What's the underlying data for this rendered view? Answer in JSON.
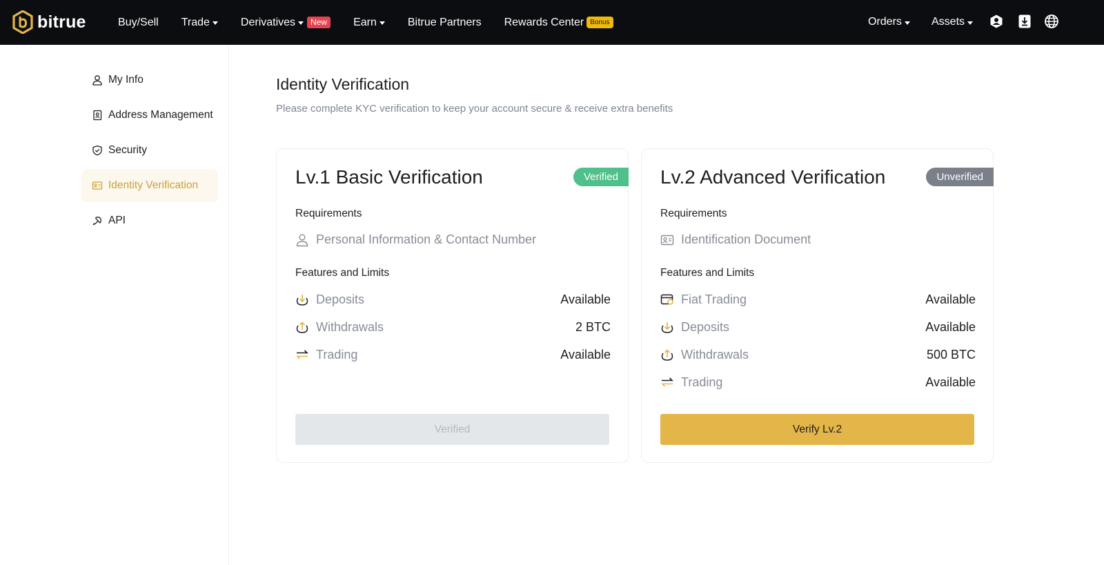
{
  "header": {
    "brand": "bitrue",
    "nav": [
      {
        "label": "Buy/Sell"
      },
      {
        "label": "Trade"
      },
      {
        "label": "Derivatives",
        "tag": "New"
      },
      {
        "label": "Earn"
      },
      {
        "label": "Bitrue Partners"
      },
      {
        "label": "Rewards Center",
        "tag": "Bonus"
      }
    ],
    "orders": "Orders",
    "assets": "Assets",
    "icons": [
      "user-circle-icon",
      "download-icon",
      "globe-icon"
    ]
  },
  "sidebar": {
    "items": [
      {
        "label": "My Info",
        "icon": "user-icon"
      },
      {
        "label": "Address Management",
        "icon": "address-book-icon"
      },
      {
        "label": "Security",
        "icon": "shield-check-icon"
      },
      {
        "label": "Identity Verification",
        "icon": "id-card-icon",
        "active": true
      },
      {
        "label": "API",
        "icon": "api-plug-icon"
      }
    ]
  },
  "main": {
    "title": "Identity Verification",
    "subtitle": "Please complete KYC verification to keep your account secure & receive extra benefits",
    "cards": [
      {
        "title": "Lv.1 Basic Verification",
        "status": "Verified",
        "requirements_label": "Requirements",
        "requirement": "Personal Information & Contact Number",
        "features_label": "Features and Limits",
        "features": [
          {
            "name": "Deposits",
            "value": "Available",
            "icon": "deposit-icon"
          },
          {
            "name": "Withdrawals",
            "value": "2 BTC",
            "icon": "withdraw-icon"
          },
          {
            "name": "Trading",
            "value": "Available",
            "icon": "trade-arrows-icon"
          }
        ],
        "button": "Verified"
      },
      {
        "title": "Lv.2 Advanced Verification",
        "status": "Unverified",
        "requirements_label": "Requirements",
        "requirement": "Identification Document",
        "features_label": "Features and Limits",
        "features": [
          {
            "name": "Fiat Trading",
            "value": "Available",
            "icon": "fiat-card-icon"
          },
          {
            "name": "Deposits",
            "value": "Available",
            "icon": "deposit-icon"
          },
          {
            "name": "Withdrawals",
            "value": "500 BTC",
            "icon": "withdraw-icon"
          },
          {
            "name": "Trading",
            "value": "Available",
            "icon": "trade-arrows-icon"
          }
        ],
        "button": "Verify Lv.2"
      }
    ]
  },
  "colors": {
    "accent": "#e4b649",
    "verified": "#4fc089",
    "unverified": "#7b7f8a",
    "topbar": "#0b0d10",
    "new_tag": "#e5434f",
    "bonus_tag": "#f0b90b"
  }
}
